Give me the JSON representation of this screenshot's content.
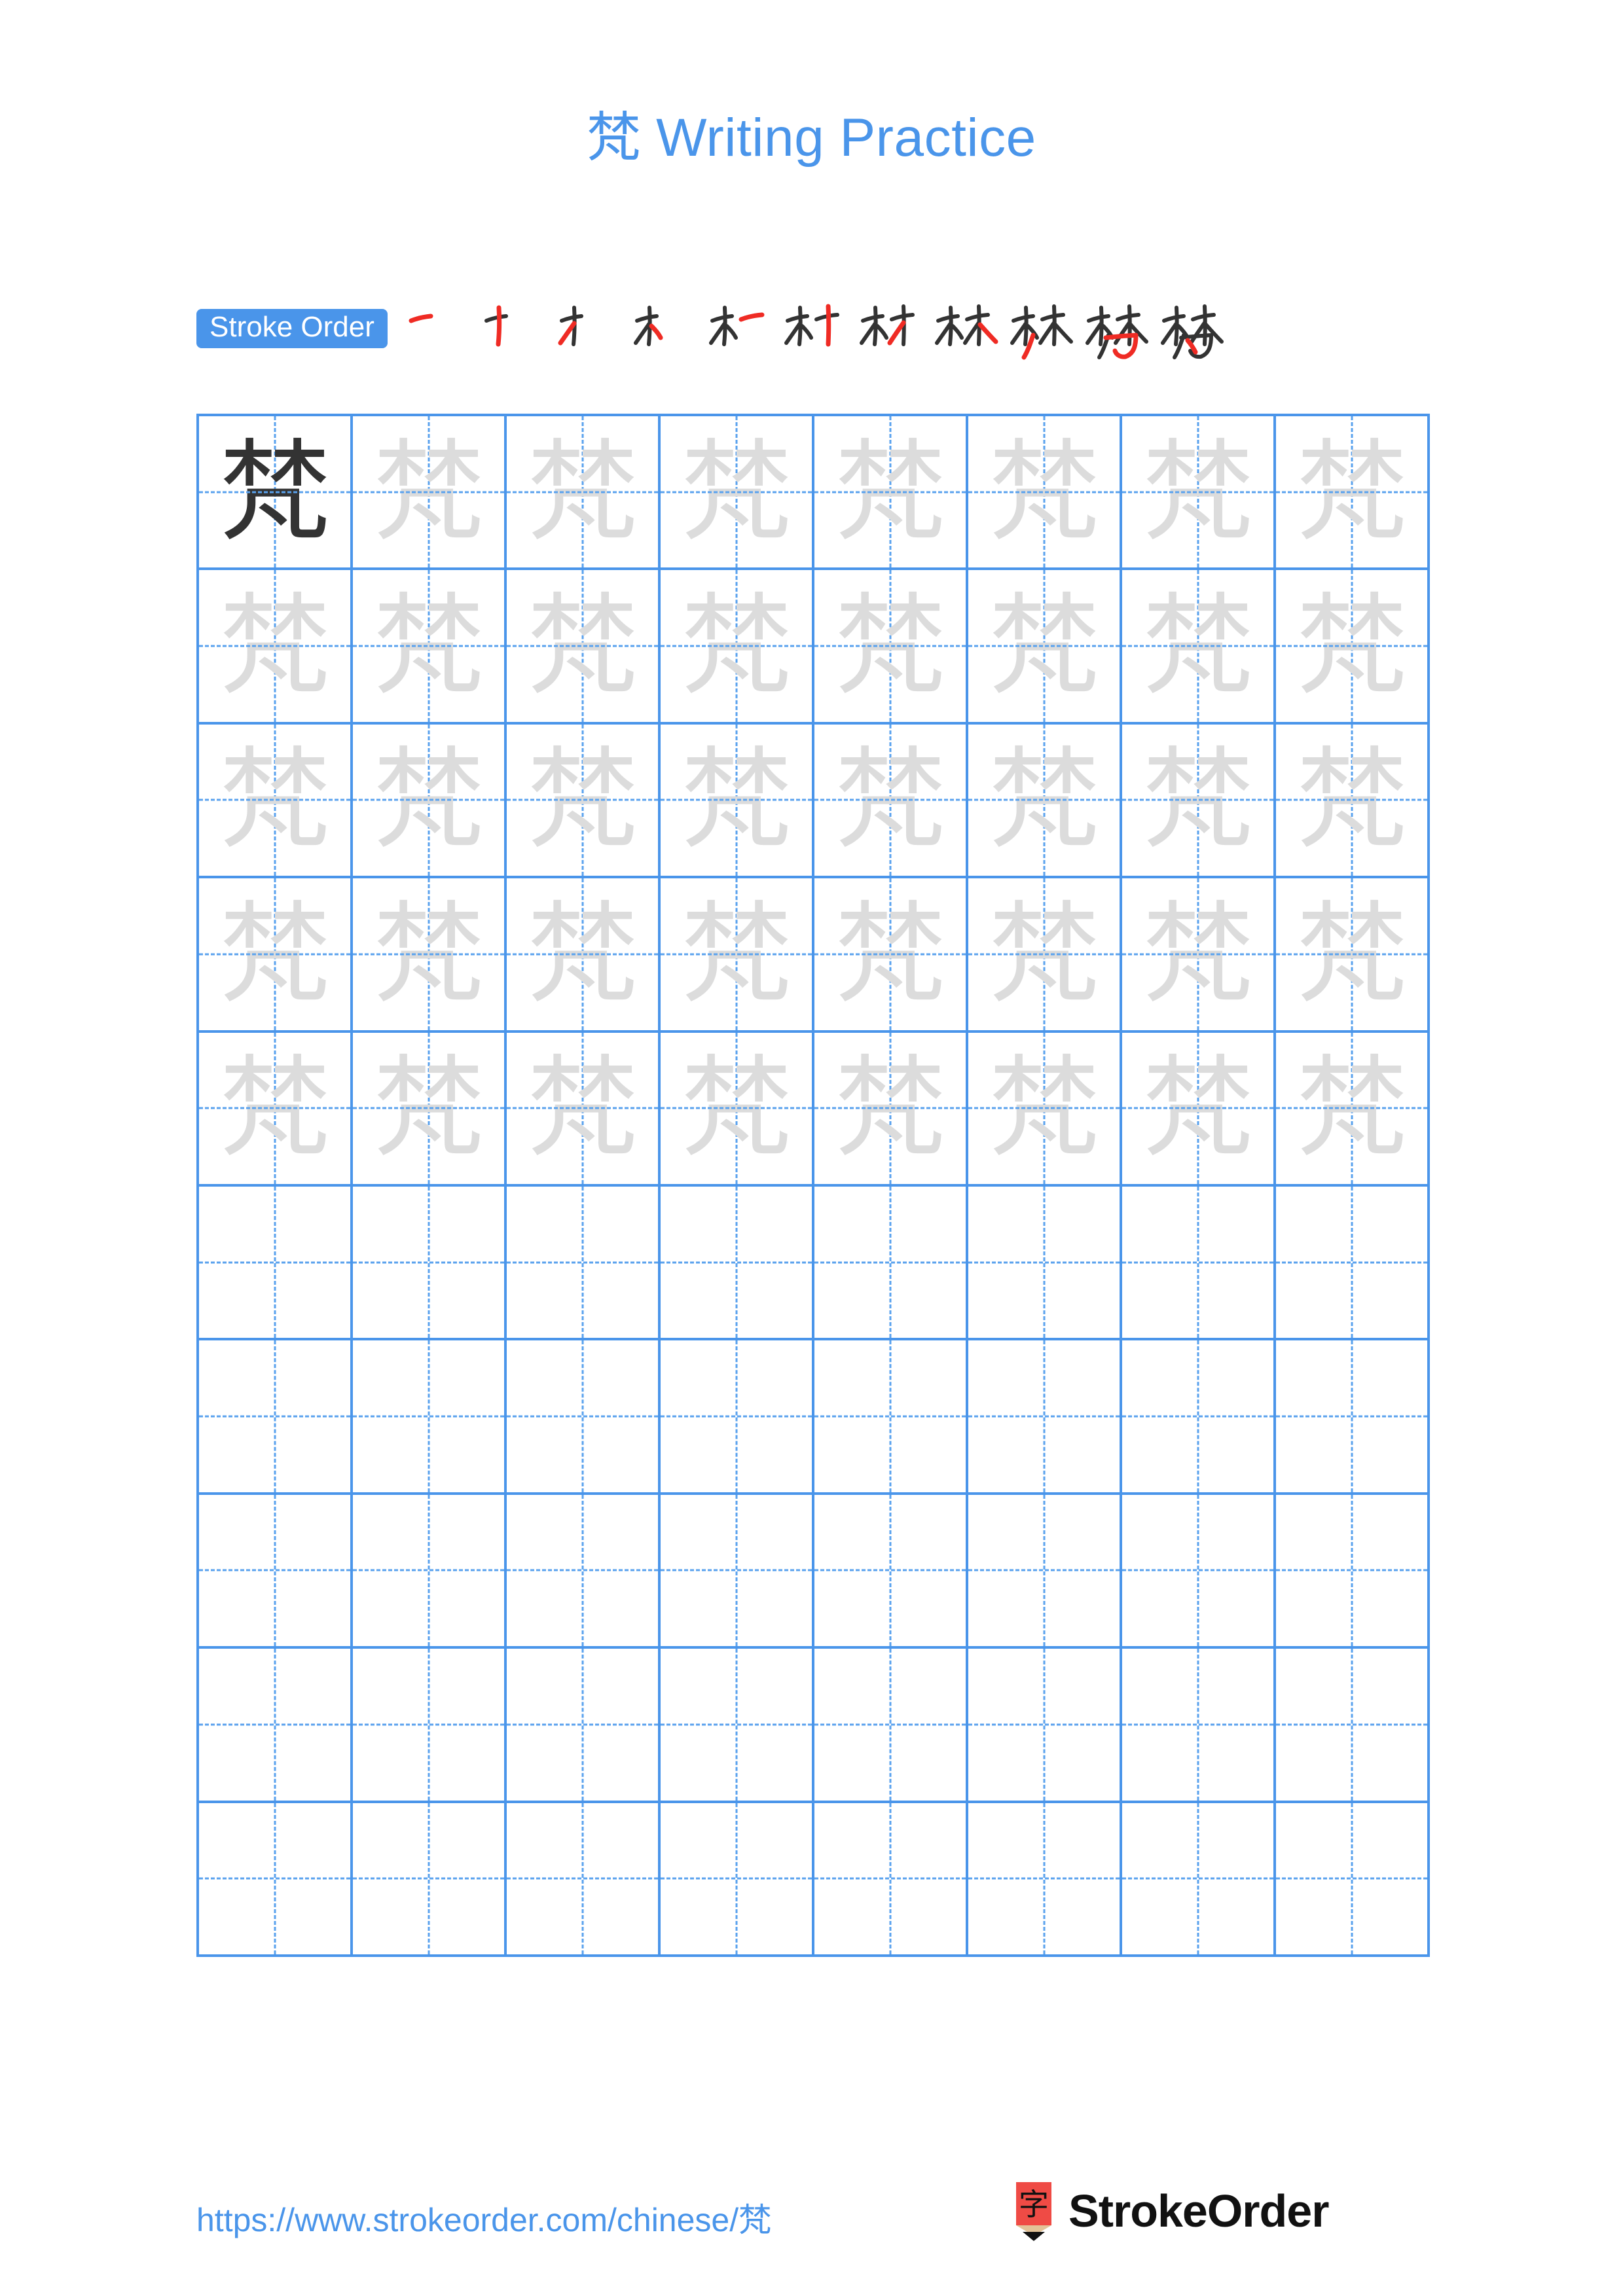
{
  "document": {
    "character": "梵",
    "title_prefix": "梵",
    "title_suffix": " Writing Practice",
    "title_full": "梵 Writing Practice"
  },
  "colors": {
    "accent_blue": "#4a95ea",
    "grid_line": "#4a95ea",
    "grid_guide": "#5aa2ee",
    "model_char": "#333333",
    "trace_char": "#dcdcdc",
    "new_stroke": "#ef2b24",
    "done_stroke": "#333333",
    "logo_red": "#ef4b45",
    "logo_wood": "#e3c398"
  },
  "stroke_order": {
    "label": "Stroke Order",
    "total_strokes": 11,
    "steps": [
      {
        "n": 1,
        "partial": "一"
      },
      {
        "n": 2,
        "partial": "十"
      },
      {
        "n": 3,
        "partial": "才"
      },
      {
        "n": 4,
        "partial": "木"
      },
      {
        "n": 5,
        "partial": "木一"
      },
      {
        "n": 6,
        "partial": "木十"
      },
      {
        "n": 7,
        "partial": "材"
      },
      {
        "n": 8,
        "partial": "林"
      },
      {
        "n": 9,
        "partial": "林丿"
      },
      {
        "n": 10,
        "partial": "梵"
      },
      {
        "n": 11,
        "partial": "梵"
      }
    ]
  },
  "grid": {
    "columns": 8,
    "rows": 10,
    "filled_rows": 5,
    "blank_rows": 5,
    "model_cell_index": 0,
    "trace_character": "梵",
    "model_character": "梵"
  },
  "footer": {
    "url": "https://www.strokeorder.com/chinese/梵",
    "brand": "StrokeOrder",
    "logo_glyph": "字"
  }
}
